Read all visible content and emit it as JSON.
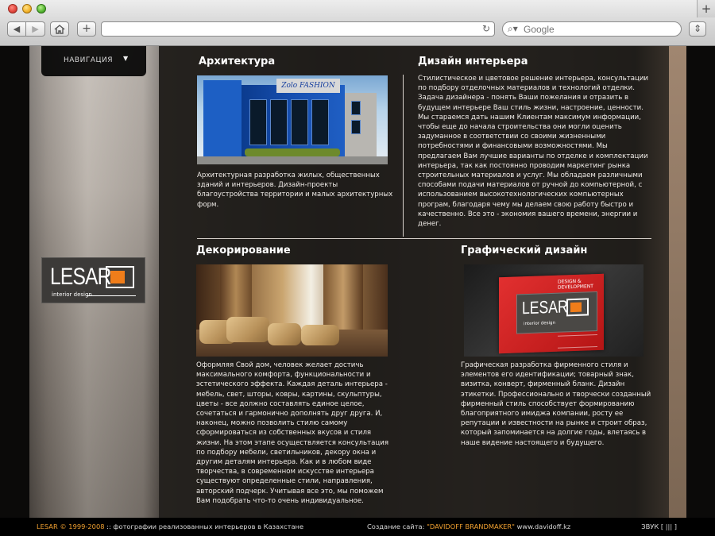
{
  "browser": {
    "search_placeholder": "Google",
    "new_tab_label": "+",
    "add_label": "+"
  },
  "nav": {
    "label": "НАВИГАЦИЯ"
  },
  "logo": {
    "name": "LESAR",
    "subtitle": "interior design"
  },
  "sections": {
    "architecture": {
      "title": "Архитектура",
      "photo_sign": "Zolo FASHION",
      "text": "Архитектурная разработка жилых, общественных зданий и интерьеров. Дизайн-проекты благоустройства территории и малых архитектурных форм."
    },
    "interior": {
      "title": "Дизайн интерьера",
      "text": "Стилистическое и цветовое решение интерьера, консультации по подбору отделочных материалов и технологий отделки. Задача дизайнера - понять Ваши пожелания и отразить в будущем интерьере Ваш стиль жизни, настроение, ценности. Мы стараемся дать нашим Клиентам максимум информации, чтобы еще до начала строительства они могли оценить задуманное в соответствии со своими жизненными потребностями и финансовыми возможностями. Мы предлагаем Вам лучшие варианты по отделке и комплектации интерьера, так как постоянно проводим маркетинг рынка строительных материалов и услуг. Мы обладаем различными способами подачи материалов от ручной до компьютерной, с использованием высокотехнологических компьютерных програм, благодаря чему мы делаем свою работу быстро и качественно. Все это - экономия вашего времени, энергии и денег."
    },
    "decor": {
      "title": "Декорирование",
      "text": "Оформляя Свой дом, человек желает достичь максимального комфорта, функциональности и эстетического эффекта. Каждая деталь интерьера - мебель, свет, шторы, ковры, картины, скульптуры, цветы - все должно составлять единое целое, сочетаться и гармонично дополнять друг друга. И, наконец, можно позволить стилю самому сформироваться из собственных вкусов и стиля жизни. На этом этапе осуществляется консультация по подбору мебели, светильников, декору окна и другим деталям интерьера. Как и в любом виде творчества, в современном искусстве интерьера существуют определенные стили, направления, авторский подчерк. Учитывая все это, мы поможем Вам подобрать что-то очень индивидуальное."
    },
    "graphic": {
      "title": "Графический дизайн",
      "card_top": "DESIGN & DEVELOPMENT",
      "text": "Графическая разработка фирменного стиля и элементов его идентификации; товарный знак, визитка, конверт, фирменный бланк. Дизайн этикетки. Профессионально и творчески созданный фирменный стиль способствует формированию благоприятного имиджа компании, росту ее репутации и известности на рынке и строит образ, который запоминается на долгие годы, влетаясь в наше видение настоящего и будущего."
    }
  },
  "footer": {
    "copyright": "LESAR © 1999-2008",
    "caption": " :: фотографии реализованных интерьеров в Казахстане",
    "created_label": "Создание сайта: ",
    "maker": "\"DAVIDOFF BRANDMAKER\"",
    "maker_url": "  www.davidoff.kz",
    "sound": "ЗВУК [ ||| ]"
  },
  "colors": {
    "accent_orange": "#f07d1a",
    "footer_orange": "#f0a030"
  }
}
